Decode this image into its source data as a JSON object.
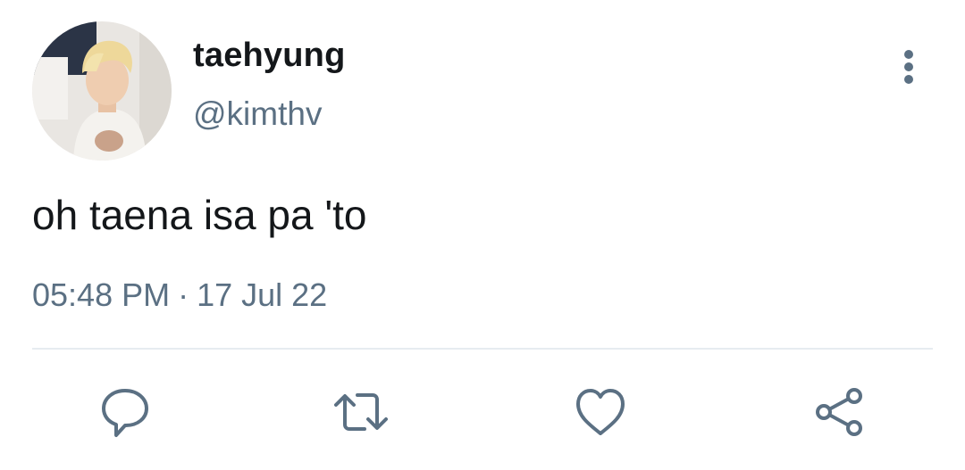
{
  "tweet": {
    "author": {
      "display_name": "taehyung",
      "handle": "@kimthv"
    },
    "text": "oh taena isa pa 'to",
    "time": "05:48 PM",
    "separator": "·",
    "date": "17 Jul 22"
  },
  "actions": [
    {
      "name": "reply",
      "icon": "reply-icon"
    },
    {
      "name": "retweet",
      "icon": "retweet-icon"
    },
    {
      "name": "like",
      "icon": "heart-icon"
    },
    {
      "name": "share",
      "icon": "share-icon"
    }
  ],
  "menu": {
    "icon": "more-vertical-icon"
  },
  "colors": {
    "text_primary": "#14171a",
    "text_secondary": "#5b7083",
    "icon": "#5b7083",
    "divider": "#e6ecf0"
  }
}
